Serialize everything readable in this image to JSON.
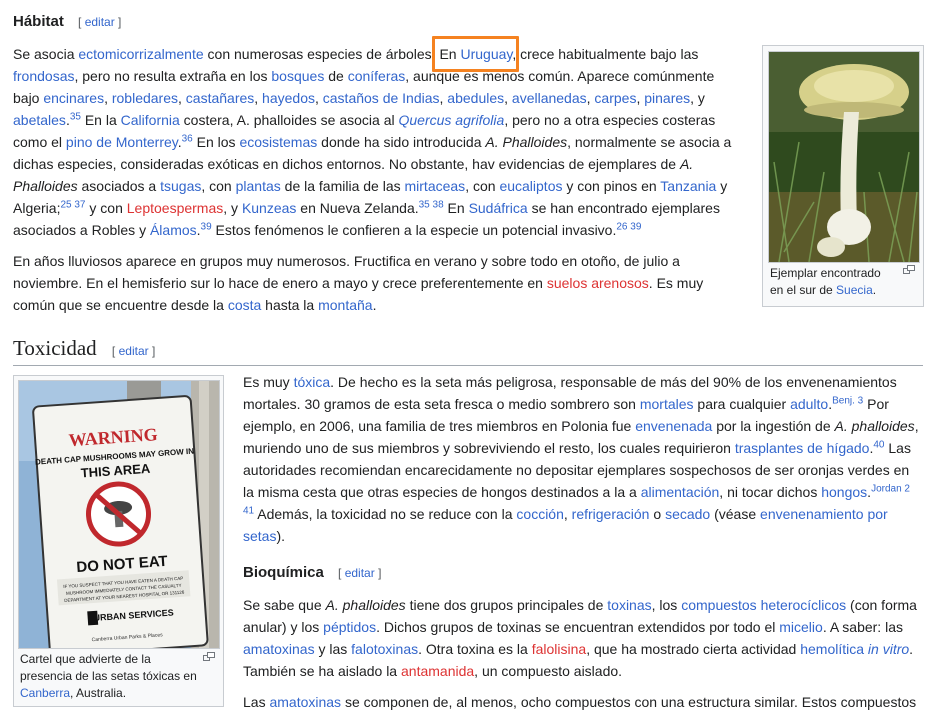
{
  "edit_label": "editar",
  "habitat": {
    "heading": "Hábitat",
    "p1": [
      {
        "t": "Se asocia "
      },
      {
        "l": "ectomicorrizalmente"
      },
      {
        "t": " con numerosas especies de árboles. "
      },
      {
        "t": "En "
      },
      {
        "l": "Uruguay"
      },
      {
        "t": ", crece habitualmente bajo las "
      },
      {
        "l": "frondosas"
      },
      {
        "t": ", pero no resulta extraña en los "
      },
      {
        "l": "bosques"
      },
      {
        "t": " de "
      },
      {
        "l": "coníferas"
      },
      {
        "t": ", aunque es menos común. Aparece comúnmente bajo "
      },
      {
        "l": "encinares"
      },
      {
        "t": ", "
      },
      {
        "l": "robledares"
      },
      {
        "t": ", "
      },
      {
        "l": "castañares"
      },
      {
        "t": ", "
      },
      {
        "l": "hayedos"
      },
      {
        "t": ", "
      },
      {
        "l": "castaños de Indias"
      },
      {
        "t": ", "
      },
      {
        "l": "abedules"
      },
      {
        "t": ", "
      },
      {
        "l": "avellanedas"
      },
      {
        "t": ", "
      },
      {
        "l": "carpes"
      },
      {
        "t": ", "
      },
      {
        "l": "pinares"
      },
      {
        "t": ", y "
      },
      {
        "l": "abetales"
      },
      {
        "t": "."
      },
      {
        "s": "35"
      },
      {
        "t": " En la "
      },
      {
        "l": "California"
      },
      {
        "t": " costera, A. phalloides se asocia al "
      },
      {
        "li": "Quercus agrifolia"
      },
      {
        "t": ", pero no a otra especies costeras como el "
      },
      {
        "l": "pino de Monterrey"
      },
      {
        "t": "."
      },
      {
        "s": "36"
      },
      {
        "t": " En los "
      },
      {
        "l": "ecosistemas"
      },
      {
        "t": " donde ha sido introducida "
      },
      {
        "i": "A. Phalloides"
      },
      {
        "t": ", normalmente se asocia a dichas especies, consideradas exóticas en dichos entornos. No obstante, hav evidencias de ejemplares de "
      },
      {
        "i": "A. Phalloides"
      },
      {
        "t": " asociados a "
      },
      {
        "l": "tsugas"
      },
      {
        "t": ", con "
      },
      {
        "l": "plantas"
      },
      {
        "t": " de la familia de las "
      },
      {
        "l": "mirtaceas"
      },
      {
        "t": ", con "
      },
      {
        "l": "eucaliptos"
      },
      {
        "t": " y con pinos en "
      },
      {
        "l": "Tanzania"
      },
      {
        "t": " y Algeria;"
      },
      {
        "s": "25 37"
      },
      {
        "t": " y con "
      },
      {
        "r": "Leptoespermas"
      },
      {
        "t": ", y "
      },
      {
        "l": "Kunzeas"
      },
      {
        "t": " en Nueva Zelanda."
      },
      {
        "s": "35 38"
      },
      {
        "t": " En "
      },
      {
        "l": "Sudáfrica"
      },
      {
        "t": " se han encontrado ejemplares asociados a Robles y "
      },
      {
        "l": "Álamos"
      },
      {
        "t": "."
      },
      {
        "s": "39"
      },
      {
        "t": " Estos fenómenos le confieren a la especie un potencial invasivo."
      },
      {
        "s": "26 39"
      }
    ],
    "p2": [
      {
        "t": "En años lluviosos aparece en grupos muy numerosos. Fructifica en verano y sobre todo en otoño, de julio a noviembre. En el hemisferio sur lo hace de enero a mayo y crece preferentemente en "
      },
      {
        "r": "suelos arenosos"
      },
      {
        "t": ". Es muy común que se encuentre desde la "
      },
      {
        "l": "costa"
      },
      {
        "t": " hasta la "
      },
      {
        "l": "montaña"
      },
      {
        "t": "."
      }
    ],
    "thumb_caption": [
      {
        "t": "Ejemplar encontrado en el sur de "
      },
      {
        "l": "Suecia"
      },
      {
        "t": "."
      }
    ]
  },
  "toxicidad": {
    "heading": "Toxicidad",
    "p1": [
      {
        "t": "Es muy "
      },
      {
        "l": "tóxica"
      },
      {
        "t": ". De hecho es la seta más peligrosa, responsable de más del 90% de los envenenamientos mortales. 30 gramos de esta seta fresca o medio sombrero son "
      },
      {
        "l": "mortales"
      },
      {
        "t": " para cualquier "
      },
      {
        "l": "adulto"
      },
      {
        "t": "."
      },
      {
        "s": "Benj. 3"
      },
      {
        "t": " Por ejemplo, en 2006, una familia de tres miembros en Polonia fue "
      },
      {
        "l": "envenenada"
      },
      {
        "t": " por la ingestión de "
      },
      {
        "i": "A. phalloides"
      },
      {
        "t": ", muriendo uno de sus miembros y sobreviviendo el resto, los cuales requirieron "
      },
      {
        "l": "trasplantes de hígado"
      },
      {
        "t": "."
      },
      {
        "s": "40"
      },
      {
        "t": " Las autoridades recomiendan encarecidamente no depositar ejemplares sospechosos de ser oronjas verdes en la misma cesta que otras especies de hongos destinados a la a "
      },
      {
        "l": "alimentación"
      },
      {
        "t": ", ni tocar dichos "
      },
      {
        "l": "hongos"
      },
      {
        "t": "."
      },
      {
        "s": "Jordan 2 41"
      },
      {
        "t": " Además, la toxicidad no se reduce con la "
      },
      {
        "l": "cocción"
      },
      {
        "t": ", "
      },
      {
        "l": "refrigeración"
      },
      {
        "t": " o "
      },
      {
        "l": "secado"
      },
      {
        "t": " (véase "
      },
      {
        "l": "envenenamiento por setas"
      },
      {
        "t": ")."
      }
    ],
    "thumb_caption": [
      {
        "t": "Cartel que advierte de la presencia de las setas tóxicas en "
      },
      {
        "l": "Canberra"
      },
      {
        "t": ", Australia."
      }
    ],
    "sign": {
      "warning": "WARNING",
      "line1": "DEATH CAP MUSHROOMS MAY GROW IN",
      "line2": "THIS AREA",
      "donot": "DO NOT EAT",
      "small": "IF YOU SUSPECT THAT YOU HAVE EATEN A DEATH CAP MUSHROOM IMMEDIATELY CONTACT THE CASUALTY DEPARTMENT AT YOUR NEAREST HOSPITAL OR 131126",
      "logo": "URBAN SERVICES",
      "footer": "Canberra Urban Parks & Places"
    }
  },
  "bioquimica": {
    "heading": "Bioquímica",
    "p1": [
      {
        "t": "Se sabe que "
      },
      {
        "i": "A. phalloides"
      },
      {
        "t": " tiene dos grupos principales de "
      },
      {
        "l": "toxinas"
      },
      {
        "t": ", los "
      },
      {
        "l": "compuestos heterocíclicos"
      },
      {
        "t": " (con forma anular) y los "
      },
      {
        "l": "péptidos"
      },
      {
        "t": ". Dichos grupos de toxinas se encuentran extendidos por todo el "
      },
      {
        "l": "micelio"
      },
      {
        "t": ". A saber: las "
      },
      {
        "l": "amatoxinas"
      },
      {
        "t": " y las "
      },
      {
        "l": "falotoxinas"
      },
      {
        "t": ". Otra toxina es la "
      },
      {
        "r": "falolisina"
      },
      {
        "t": ", que ha mostrado cierta actividad "
      },
      {
        "l": "hemolítica"
      },
      {
        "t": " "
      },
      {
        "li": "in vitro"
      },
      {
        "t": ". También se ha aislado la "
      },
      {
        "r": "antamanida"
      },
      {
        "t": ", un compuesto aislado."
      }
    ],
    "p2": [
      {
        "t": "Las "
      },
      {
        "l": "amatoxinas"
      },
      {
        "t": " se componen de, al menos, ocho compuestos con una estructura similar. Estos compuestos"
      }
    ]
  },
  "colors": {
    "link": "#3366cc",
    "redlink": "#d33",
    "highlight": "#f58220",
    "text": "#202122"
  },
  "icons": {
    "magnify": "magnify-icon"
  }
}
